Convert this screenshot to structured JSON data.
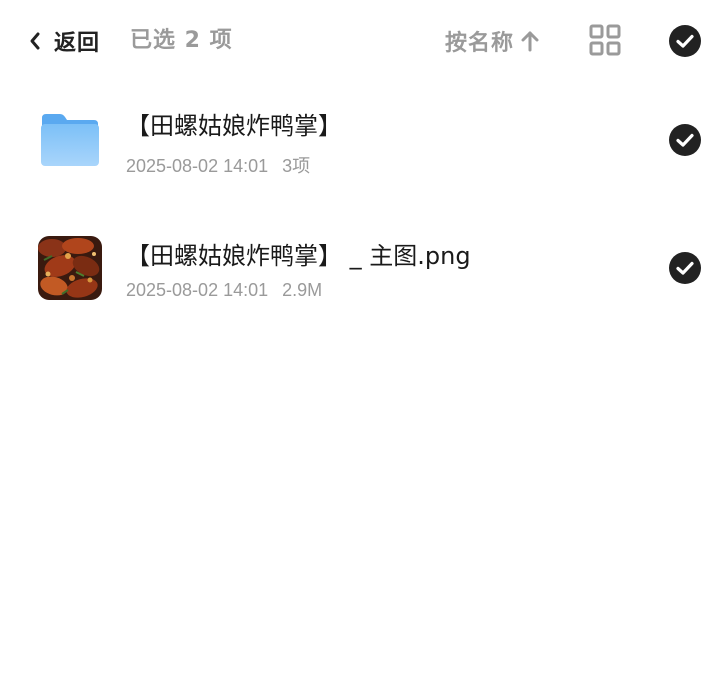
{
  "header": {
    "back_label": "返回",
    "selected_count": "已选 2 项",
    "sort_label": "按名称"
  },
  "icons": {
    "back": "chevron-left-icon",
    "sort_direction": "arrow-up-icon",
    "view": "grid-view-icon",
    "selected": "checkmark-circle-icon",
    "folder": "folder-icon"
  },
  "colors": {
    "check_fill": "#222222",
    "folder_blue": "#5aa9f0",
    "muted_text": "#9a9a9a"
  },
  "files": [
    {
      "name": "【田螺姑娘炸鸭掌】",
      "date": "2025-08-02 14:01",
      "size": "3项",
      "type": "folder",
      "selected": true
    },
    {
      "name": "【田螺姑娘炸鸭掌】 _ 主图.png",
      "date": "2025-08-02 14:01",
      "size": "2.9M",
      "type": "image",
      "selected": true
    }
  ]
}
